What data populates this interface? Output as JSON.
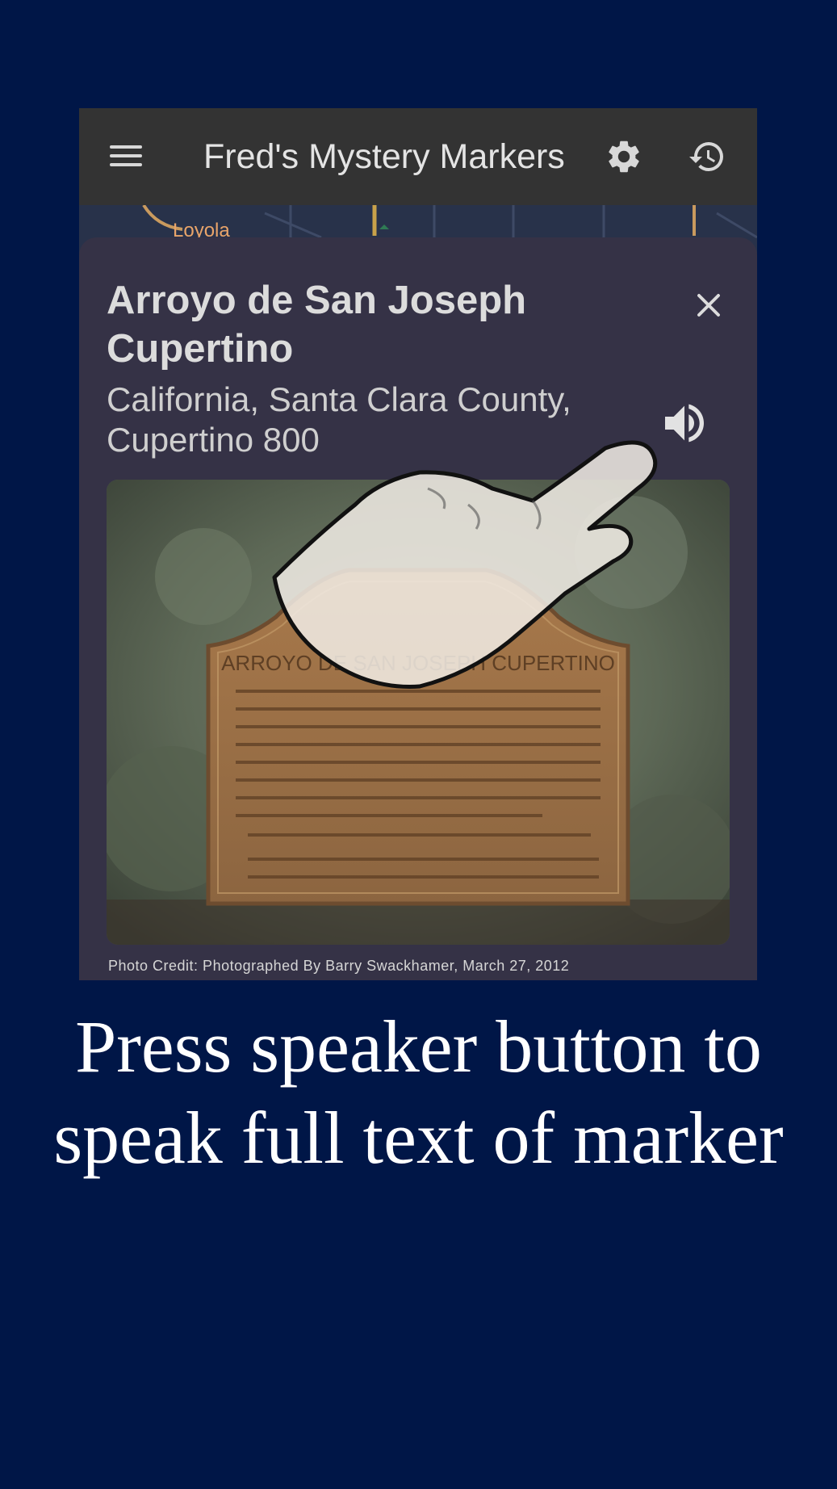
{
  "app": {
    "title": "Fred's Mystery Markers",
    "icons": {
      "menu": "menu-icon",
      "settings": "gear-icon",
      "history": "history-icon"
    }
  },
  "map": {
    "place_label": "Loyola"
  },
  "marker": {
    "name": "Arroyo de San Joseph Cupertino",
    "location": "California, Santa Clara County,\nCupertino  800",
    "photo_credit": "Photo Credit: Photographed By Barry Swackhamer, March 27, 2012",
    "photo_alt": "Marker plaque on a rock",
    "plaque_heading": "ARROYO DE SAN JOSEPH CUPERTINO",
    "close_icon": "close-icon",
    "speaker_icon": "speaker-icon"
  },
  "caption": "Press speaker button to speak full text of marker",
  "colors": {
    "background": "#001647",
    "app_bar": "#333333",
    "card": "#353246",
    "map_label": "#e9a46a"
  }
}
